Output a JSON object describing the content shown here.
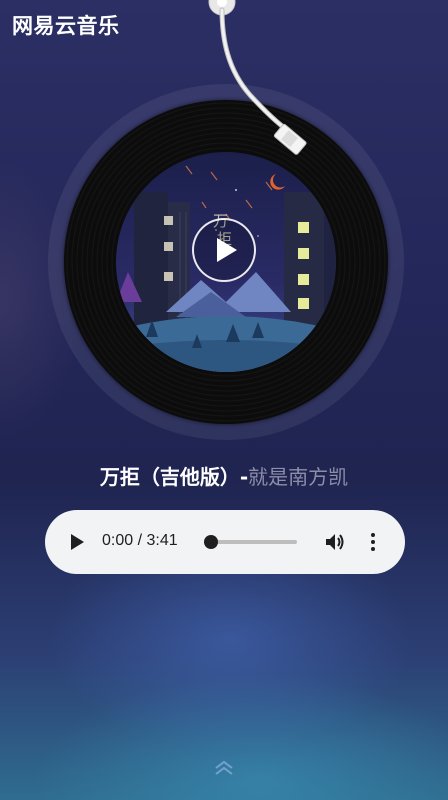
{
  "app": {
    "title": "网易云音乐"
  },
  "song": {
    "title": "万拒（吉他版）",
    "separator": "-",
    "artist": "就是南方凯"
  },
  "player": {
    "time_display": "0:00 / 3:41",
    "progress": 0.0
  },
  "cover": {
    "calligraphy": "万拒"
  },
  "icons": {
    "play": "play-icon",
    "audio_play": "play-triangle-icon",
    "volume": "speaker-icon",
    "more": "vertical-dots-icon",
    "expand": "double-chevron-up-icon"
  },
  "colors": {
    "accent": "#ffffff",
    "artist": "#8d8ea8",
    "player_bg": "#f1f3f4"
  }
}
